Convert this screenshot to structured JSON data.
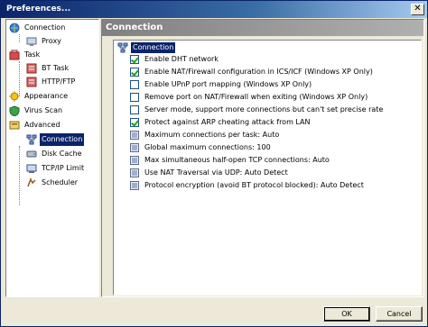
{
  "window": {
    "title": "Preferences...",
    "close_glyph": "✕"
  },
  "tree": {
    "items": [
      {
        "label": "Connection",
        "icon": "connection-icon"
      },
      {
        "label": "Proxy",
        "icon": "proxy-icon"
      },
      {
        "label": "Task",
        "icon": "task-icon"
      },
      {
        "label": "BT Task",
        "icon": "bt-task-icon"
      },
      {
        "label": "HTTP/FTP",
        "icon": "http-ftp-icon"
      },
      {
        "label": "Appearance",
        "icon": "appearance-icon"
      },
      {
        "label": "Virus Scan",
        "icon": "virus-scan-icon"
      },
      {
        "label": "Advanced",
        "icon": "advanced-icon"
      },
      {
        "label": "Connection",
        "icon": "network-icon",
        "selected": true
      },
      {
        "label": "Disk Cache",
        "icon": "disk-cache-icon"
      },
      {
        "label": "TCP/IP Limit",
        "icon": "tcpip-icon"
      },
      {
        "label": "Scheduler",
        "icon": "scheduler-icon"
      }
    ]
  },
  "content": {
    "header": "Connection",
    "root_label": "Connection",
    "options": [
      {
        "type": "checkbox",
        "checked": true,
        "label": "Enable DHT network"
      },
      {
        "type": "checkbox",
        "checked": true,
        "label": "Enable NAT/Firewall configuration in ICS/ICF (Windows XP Only)"
      },
      {
        "type": "checkbox",
        "checked": false,
        "label": "Enable UPnP port mapping (Windows XP Only)"
      },
      {
        "type": "checkbox",
        "checked": false,
        "label": "Remove port on NAT/Firewall when exiting (Windows XP Only)"
      },
      {
        "type": "checkbox",
        "checked": false,
        "label": "Server mode, support more connections but can't set precise rate"
      },
      {
        "type": "checkbox",
        "checked": true,
        "label": "Protect against ARP cheating attack from LAN"
      },
      {
        "type": "select",
        "label": "Maximum connections per task: Auto"
      },
      {
        "type": "select",
        "label": "Global maximum connections: 100"
      },
      {
        "type": "select",
        "label": "Max simultaneous half-open TCP connections: Auto"
      },
      {
        "type": "select",
        "label": "Use NAT Traversal via UDP: Auto Detect"
      },
      {
        "type": "select",
        "label": "Protocol encryption (avoid BT protocol blocked): Auto Detect"
      }
    ]
  },
  "buttons": {
    "ok": "OK",
    "cancel": "Cancel"
  }
}
